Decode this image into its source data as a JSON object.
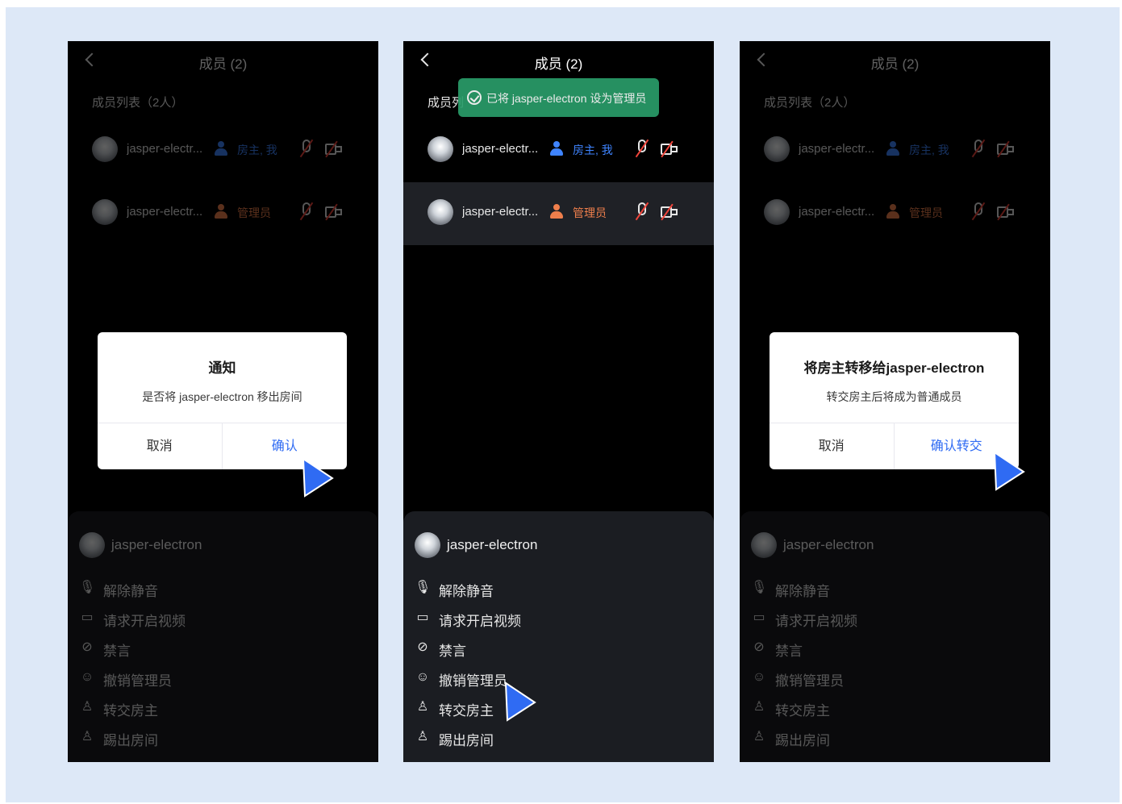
{
  "panels": [
    {
      "title": "成员 (2)",
      "section_label": "成员列表（2人）",
      "members": [
        {
          "name": "jasper-electr...",
          "role": "房主, 我",
          "role_color": "#3f84ff"
        },
        {
          "name": "jasper-electr...",
          "role": "管理员",
          "role_color": "#ef7f4c"
        }
      ],
      "sheet": {
        "name": "jasper-electron",
        "actions": [
          "解除静音",
          "请求开启视频",
          "禁言",
          "撤销管理员",
          "转交房主",
          "踢出房间"
        ]
      },
      "dialog": {
        "title": "通知",
        "message": "是否将 jasper-electron 移出房间",
        "cancel": "取消",
        "confirm": "确认"
      }
    },
    {
      "title": "成员 (2)",
      "section_label": "成员列",
      "toast": "已将 jasper-electron 设为管理员",
      "members": [
        {
          "name": "jasper-electr...",
          "role": "房主, 我",
          "role_color": "#3f84ff"
        },
        {
          "name": "jasper-electr...",
          "role": "管理员",
          "role_color": "#ef7f4c"
        }
      ],
      "sheet": {
        "name": "jasper-electron",
        "actions": [
          "解除静音",
          "请求开启视频",
          "禁言",
          "撤销管理员",
          "转交房主",
          "踢出房间"
        ]
      }
    },
    {
      "title": "成员 (2)",
      "section_label": "成员列表（2人）",
      "members": [
        {
          "name": "jasper-electr...",
          "role": "房主, 我",
          "role_color": "#3f84ff"
        },
        {
          "name": "jasper-electr...",
          "role": "管理员",
          "role_color": "#ef7f4c"
        }
      ],
      "sheet": {
        "name": "jasper-electron",
        "actions": [
          "解除静音",
          "请求开启视频",
          "禁言",
          "撤销管理员",
          "转交房主",
          "踢出房间"
        ]
      },
      "dialog": {
        "title": "将房主转移给jasper-electron",
        "message": "转交房主后将成为普通成员",
        "cancel": "取消",
        "confirm": "确认转交"
      }
    }
  ],
  "icons": {
    "back": "chevron-left-icon",
    "member_role": "person-icon",
    "mic": "mic-off-icon",
    "camera": "camera-off-icon",
    "toast": "check-circle-icon",
    "actions": [
      "mic-icon",
      "video-icon",
      "mute-chat-icon",
      "revoke-admin-icon",
      "transfer-owner-icon",
      "kick-out-icon"
    ]
  },
  "colors": {
    "background": "#dde8f7",
    "phone_bg": "#000000",
    "sheet_bg": "#1b1d22",
    "owner_blue": "#3f84ff",
    "admin_orange": "#ef7f4c",
    "confirm_blue": "#2f6bf3",
    "toast_green": "#2a9d6a",
    "cursor_blue": "#2f6bf3"
  }
}
